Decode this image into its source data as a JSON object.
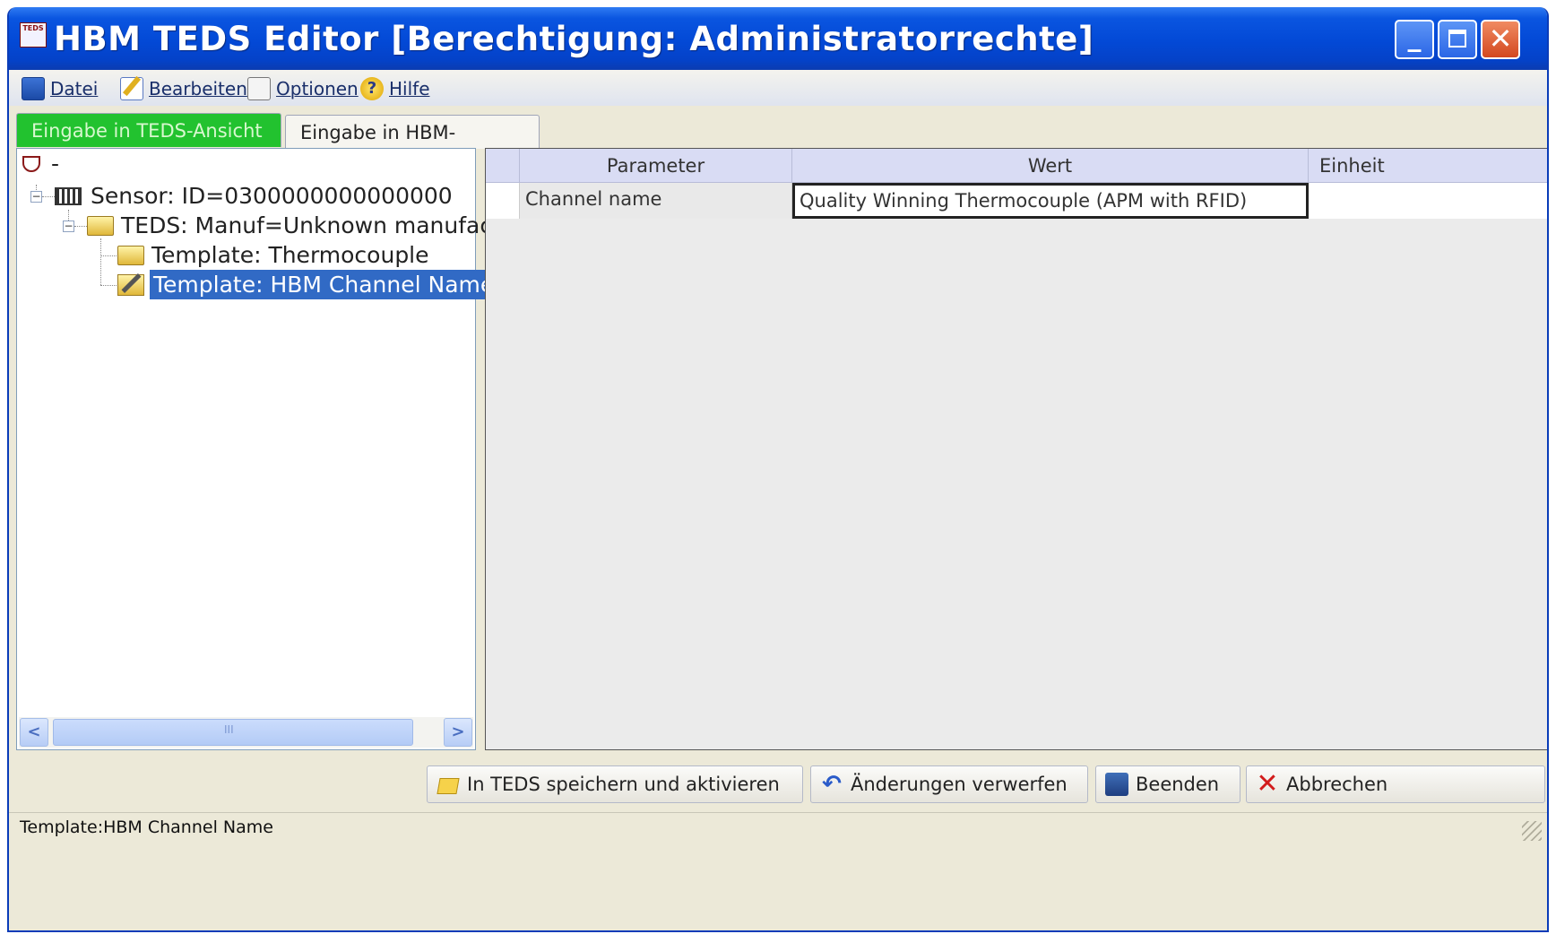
{
  "window": {
    "title": "HBM TEDS Editor [Berechtigung: Administratorrechte]",
    "icon_text": "TEDS",
    "controls": {
      "minimize": "_",
      "close": "✕"
    }
  },
  "menu": {
    "items": [
      {
        "label": "Datei",
        "icon": "save-disk-icon"
      },
      {
        "label": "Bearbeiten",
        "icon": "edit-pencil-icon"
      },
      {
        "label": "Optionen",
        "icon": "options-icon"
      },
      {
        "label": "Hilfe",
        "icon": "help-icon",
        "glyph": "?"
      }
    ]
  },
  "tabs": [
    {
      "label": "Eingabe in TEDS-Ansicht",
      "active": true
    },
    {
      "label": "Eingabe in HBM-Ansicht",
      "active": false
    }
  ],
  "tree": {
    "root_label": "-",
    "nodes": [
      {
        "label": "Sensor: ID=0300000000000000",
        "level": 1,
        "icon": "sensor-icon",
        "expanded": true
      },
      {
        "label": "TEDS: Manuf=Unknown manufact",
        "level": 2,
        "icon": "folder-icon",
        "expanded": true
      },
      {
        "label": "Template: Thermocouple",
        "level": 3,
        "icon": "folder-icon"
      },
      {
        "label": "Template: HBM Channel Name",
        "level": 3,
        "icon": "edit-icon",
        "selected": true
      }
    ],
    "expander_glyph": "−",
    "scroll": {
      "left": "<",
      "right": ">",
      "thumb_grip": "III"
    }
  },
  "grid": {
    "columns": [
      "Parameter",
      "Wert",
      "Einheit"
    ],
    "rows": [
      {
        "parameter": "Channel name",
        "value": "Quality Winning Thermocouple (APM with RFID)",
        "unit": ""
      }
    ]
  },
  "buttons": {
    "save": "In TEDS speichern und aktivieren",
    "discard": "Änderungen verwerfen",
    "exit": "Beenden",
    "cancel": "Abbrechen",
    "undo_glyph": "↶",
    "cancel_glyph": "✕"
  },
  "status": {
    "text": "Template:HBM Channel Name"
  },
  "colors": {
    "title_bar": "#0349d6",
    "active_tab": "#22c22f",
    "selection": "#316ac5",
    "grid_header": "#d9dcf4"
  }
}
